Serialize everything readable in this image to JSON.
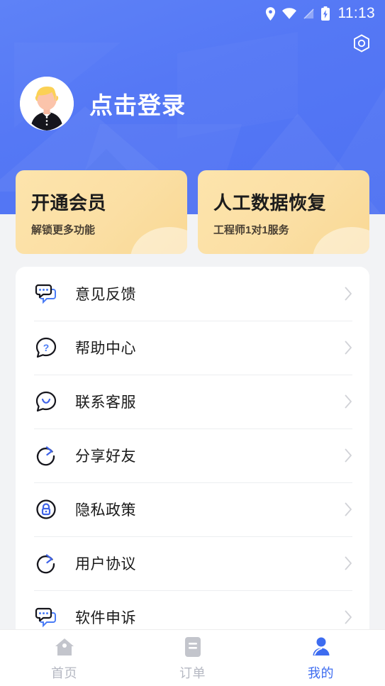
{
  "status_bar": {
    "time": "11:13",
    "icons": [
      "location-icon",
      "wifi-icon",
      "signal-icon",
      "battery-charging-icon"
    ]
  },
  "header": {
    "settings_icon": "settings-gear-icon",
    "avatar_icon": "user-avatar-illustration",
    "login_label": "点击登录",
    "accent_color": "#5578f5"
  },
  "promos": [
    {
      "title": "开通会员",
      "subtitle": "解锁更多功能",
      "color": "#fbdfa4"
    },
    {
      "title": "人工数据恢复",
      "subtitle": "工程师1对1服务",
      "color": "#fbdfa4"
    }
  ],
  "menu": {
    "items": [
      {
        "label": "意见反馈",
        "icon": "chat-bubbles-icon"
      },
      {
        "label": "帮助中心",
        "icon": "question-bubble-icon"
      },
      {
        "label": "联系客服",
        "icon": "smile-bubble-icon"
      },
      {
        "label": "分享好友",
        "icon": "share-refresh-icon"
      },
      {
        "label": "隐私政策",
        "icon": "lock-circle-icon"
      },
      {
        "label": "用户协议",
        "icon": "share-refresh-icon"
      },
      {
        "label": "软件申诉",
        "icon": "chat-bubbles-icon"
      }
    ],
    "chevron_icon": "chevron-right-icon"
  },
  "tabbar": {
    "active_color": "#3d6cf0",
    "inactive_color": "#b5b8c2",
    "tabs": [
      {
        "label": "首页",
        "icon": "home-icon",
        "active": false
      },
      {
        "label": "订单",
        "icon": "order-document-icon",
        "active": false
      },
      {
        "label": "我的",
        "icon": "profile-person-icon",
        "active": true
      }
    ]
  }
}
